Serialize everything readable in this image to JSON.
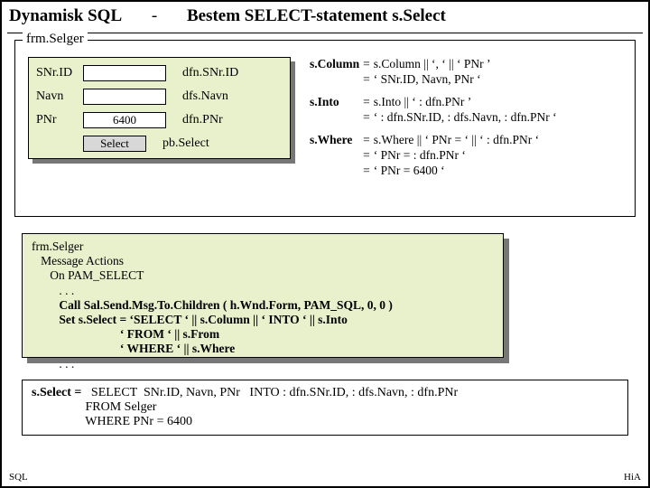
{
  "header": {
    "title_left": "Dynamisk SQL",
    "title_sep": "-",
    "title_right": "Bestem SELECT-statement s.Select"
  },
  "form": {
    "caption": "frm.Selger",
    "fields": [
      {
        "label": "SNr.ID",
        "value": "",
        "dfn": "dfn.SNr.ID"
      },
      {
        "label": "Navn",
        "value": "",
        "dfn": "dfs.Navn"
      },
      {
        "label": "PNr",
        "value": "6400",
        "dfn": "dfn.PNr"
      }
    ],
    "button": {
      "label": "Select",
      "dfn": "pb.Select"
    }
  },
  "expr": [
    {
      "k": "s.Column",
      "l1": "s.Column || ‘, ‘ || ‘ PNr ’",
      "l2": "‘ SNr.ID, Navn, PNr ‘"
    },
    {
      "k": "s.Into",
      "l1": "s.Into || ‘ : dfn.PNr ’",
      "l2": "‘ : dfn.SNr.ID, : dfs.Navn, : dfn.PNr ‘"
    },
    {
      "k": "s.Where",
      "l1": "s.Where || ‘ PNr = ‘ || ‘ : dfn.PNr ‘",
      "l2": "‘ PNr = : dfn.PNr ‘",
      "l3": "‘ PNr = 6400 ‘"
    }
  ],
  "code": [
    "frm.Selger",
    "   Message Actions",
    "      On PAM_SELECT",
    "         . . .",
    "         Call Sal.Send.Msg.To.Children ( h.Wnd.Form, PAM_SQL, 0, 0 )",
    "         Set s.Select = ‘SELECT ‘ || s.Column || ‘ INTO ‘ || s.Into",
    "                             ‘ FROM ‘ || s.From",
    "                             ‘ WHERE ‘ || s.Where",
    "         . . ."
  ],
  "result": {
    "lead": "s.Select =   ",
    "l1": "SELECT  SNr.ID, Navn, PNr   INTO : dfn.SNr.ID, : dfs.Navn, : dfn.PNr",
    "l2": "                 FROM Selger",
    "l3": "                 WHERE PNr = 6400"
  },
  "footer": {
    "left": "SQL",
    "right": "HiA"
  }
}
